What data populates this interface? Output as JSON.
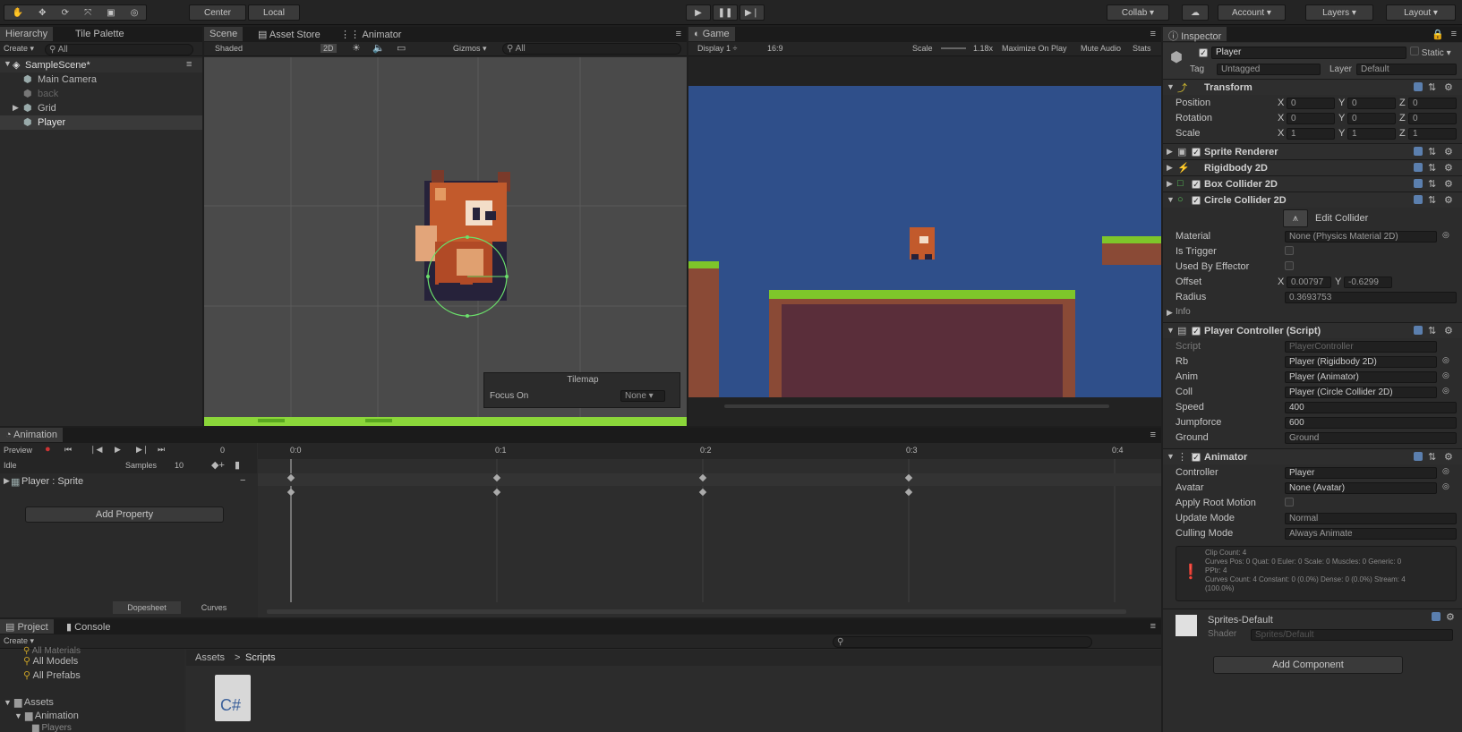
{
  "toolbar": {
    "center": "Center",
    "local": "Local",
    "collab": "Collab",
    "account": "Account",
    "layers": "Layers",
    "layout": "Layout"
  },
  "hierarchy": {
    "tab": "Hierarchy",
    "tab2": "Tile Palette",
    "create": "Create",
    "search": "All",
    "scene": "SampleScene*",
    "items": [
      "Main Camera",
      "back",
      "Grid",
      "Player"
    ]
  },
  "scene": {
    "tabs": [
      "Scene",
      "Asset Store",
      "Animator"
    ],
    "shaded": "Shaded",
    "mode2d": "2D",
    "gizmos": "Gizmos",
    "search": "All",
    "tilemap_title": "Tilemap",
    "focus_label": "Focus On",
    "focus_value": "None"
  },
  "game": {
    "tab": "Game",
    "display": "Display 1",
    "aspect": "16:9",
    "scale_label": "Scale",
    "scale_value": "1.18x",
    "opts": [
      "Maximize On Play",
      "Mute Audio",
      "Stats"
    ]
  },
  "animation": {
    "tab": "Animation",
    "preview": "Preview",
    "frame": "0",
    "clip": "Idle",
    "samples_label": "Samples",
    "samples": "10",
    "property": "Player : Sprite",
    "add_property": "Add Property",
    "ruler": [
      "0:0",
      "0:1",
      "0:2",
      "0:3",
      "0:4"
    ],
    "dopesheet": "Dopesheet",
    "curves": "Curves"
  },
  "project": {
    "tabs": [
      "Project",
      "Console"
    ],
    "create": "Create",
    "favorites": [
      "All Materials",
      "All Models",
      "All Prefabs"
    ],
    "assets": "Assets",
    "animation": "Animation",
    "players": "Players",
    "breadcrumb": [
      "Assets",
      "Scripts"
    ],
    "file_icon": "C#"
  },
  "inspector": {
    "tab": "Inspector",
    "name": "Player",
    "static": "Static",
    "tag_label": "Tag",
    "tag": "Untagged",
    "layer_label": "Layer",
    "layer": "Default",
    "transform": {
      "title": "Transform",
      "rows": [
        {
          "label": "Position",
          "x": "0",
          "y": "0",
          "z": "0"
        },
        {
          "label": "Rotation",
          "x": "0",
          "y": "0",
          "z": "0"
        },
        {
          "label": "Scale",
          "x": "1",
          "y": "1",
          "z": "1"
        }
      ]
    },
    "components": [
      "Sprite Renderer",
      "Rigidbody 2D",
      "Box Collider 2D",
      "Circle Collider 2D"
    ],
    "edit_collider": "Edit Collider",
    "circle": {
      "material_label": "Material",
      "material": "None (Physics Material 2D)",
      "trigger": "Is Trigger",
      "effector": "Used By Effector",
      "offset_label": "Offset",
      "offset_x": "0.00797",
      "offset_y": "-0.6299",
      "radius_label": "Radius",
      "radius": "0.3693753",
      "info": "Info"
    },
    "controller": {
      "title": "Player Controller (Script)",
      "rows": [
        {
          "label": "Script",
          "value": "PlayerController"
        },
        {
          "label": "Rb",
          "value": "Player (Rigidbody 2D)"
        },
        {
          "label": "Anim",
          "value": "Player (Animator)"
        },
        {
          "label": "Coll",
          "value": "Player (Circle Collider 2D)"
        },
        {
          "label": "Speed",
          "value": "400"
        },
        {
          "label": "Jumpforce",
          "value": "600"
        },
        {
          "label": "Ground",
          "value": "Ground"
        }
      ]
    },
    "animator": {
      "title": "Animator",
      "rows": [
        {
          "label": "Controller",
          "value": "Player"
        },
        {
          "label": "Avatar",
          "value": "None (Avatar)"
        },
        {
          "label": "Apply Root Motion",
          "value": ""
        },
        {
          "label": "Update Mode",
          "value": "Normal"
        },
        {
          "label": "Culling Mode",
          "value": "Always Animate"
        }
      ],
      "info": [
        "Clip Count: 4",
        "Curves Pos: 0 Quat: 0 Euler: 0 Scale: 0 Muscles: 0 Generic: 0",
        "PPtr: 4",
        "Curves Count: 4 Constant: 0 (0.0%) Dense: 0 (0.0%) Stream: 4",
        "(100.0%)"
      ]
    },
    "material": "Sprites-Default",
    "shader_label": "Shader",
    "shader": "Sprites/Default",
    "add_component": "Add Component"
  },
  "colors": {
    "sky": "#2f4f8a",
    "grass": "#7ec62a",
    "dirt": "#5a2e3a",
    "accent": "#3a6ea5"
  }
}
